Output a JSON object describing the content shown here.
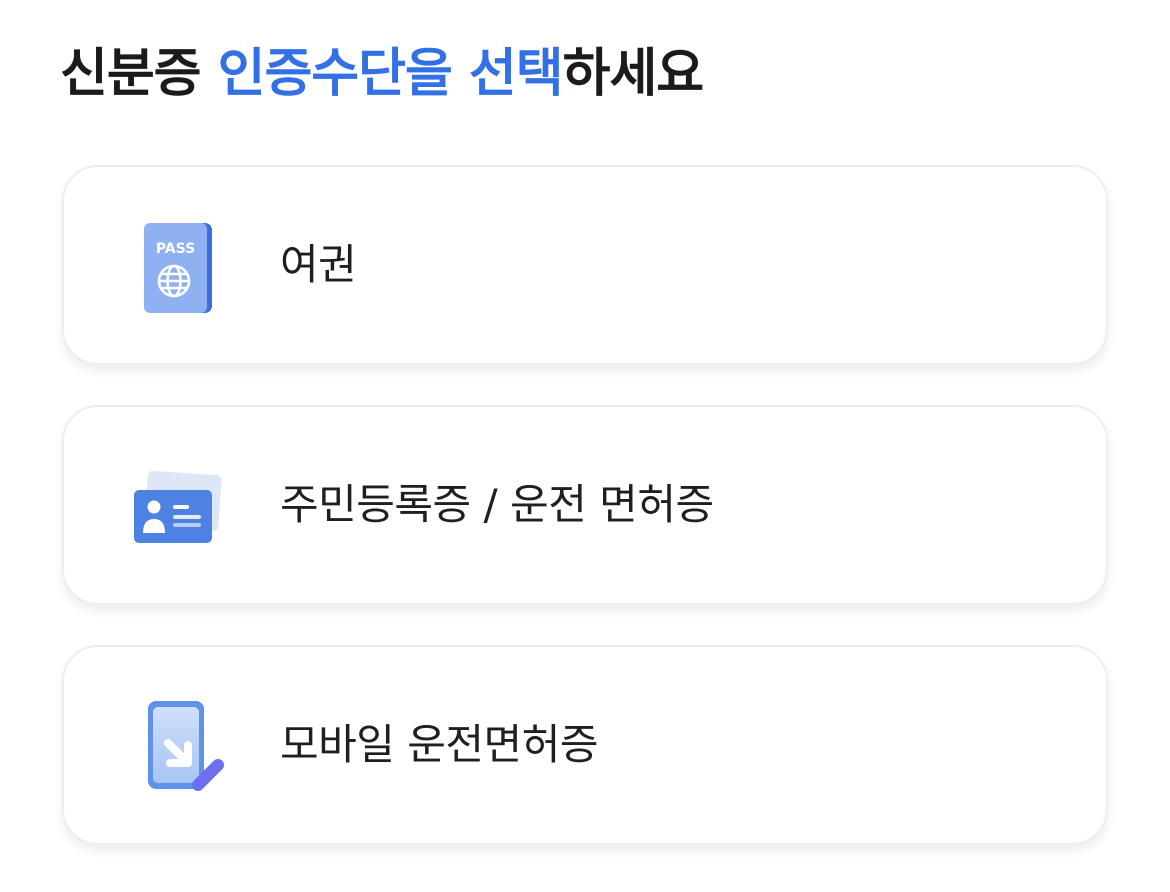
{
  "header": {
    "title_prefix": "신분증 ",
    "title_highlight": "인증수단을 선택",
    "title_suffix": "하세요",
    "accent_color": "#3370e6"
  },
  "options": [
    {
      "label": "여권",
      "icon": "passport-icon",
      "icon_text": "PASS"
    },
    {
      "label": "주민등록증 / 운전 면허증",
      "icon": "id-card-icon"
    },
    {
      "label": "모바일 운전면허증",
      "icon": "mobile-license-icon"
    }
  ]
}
